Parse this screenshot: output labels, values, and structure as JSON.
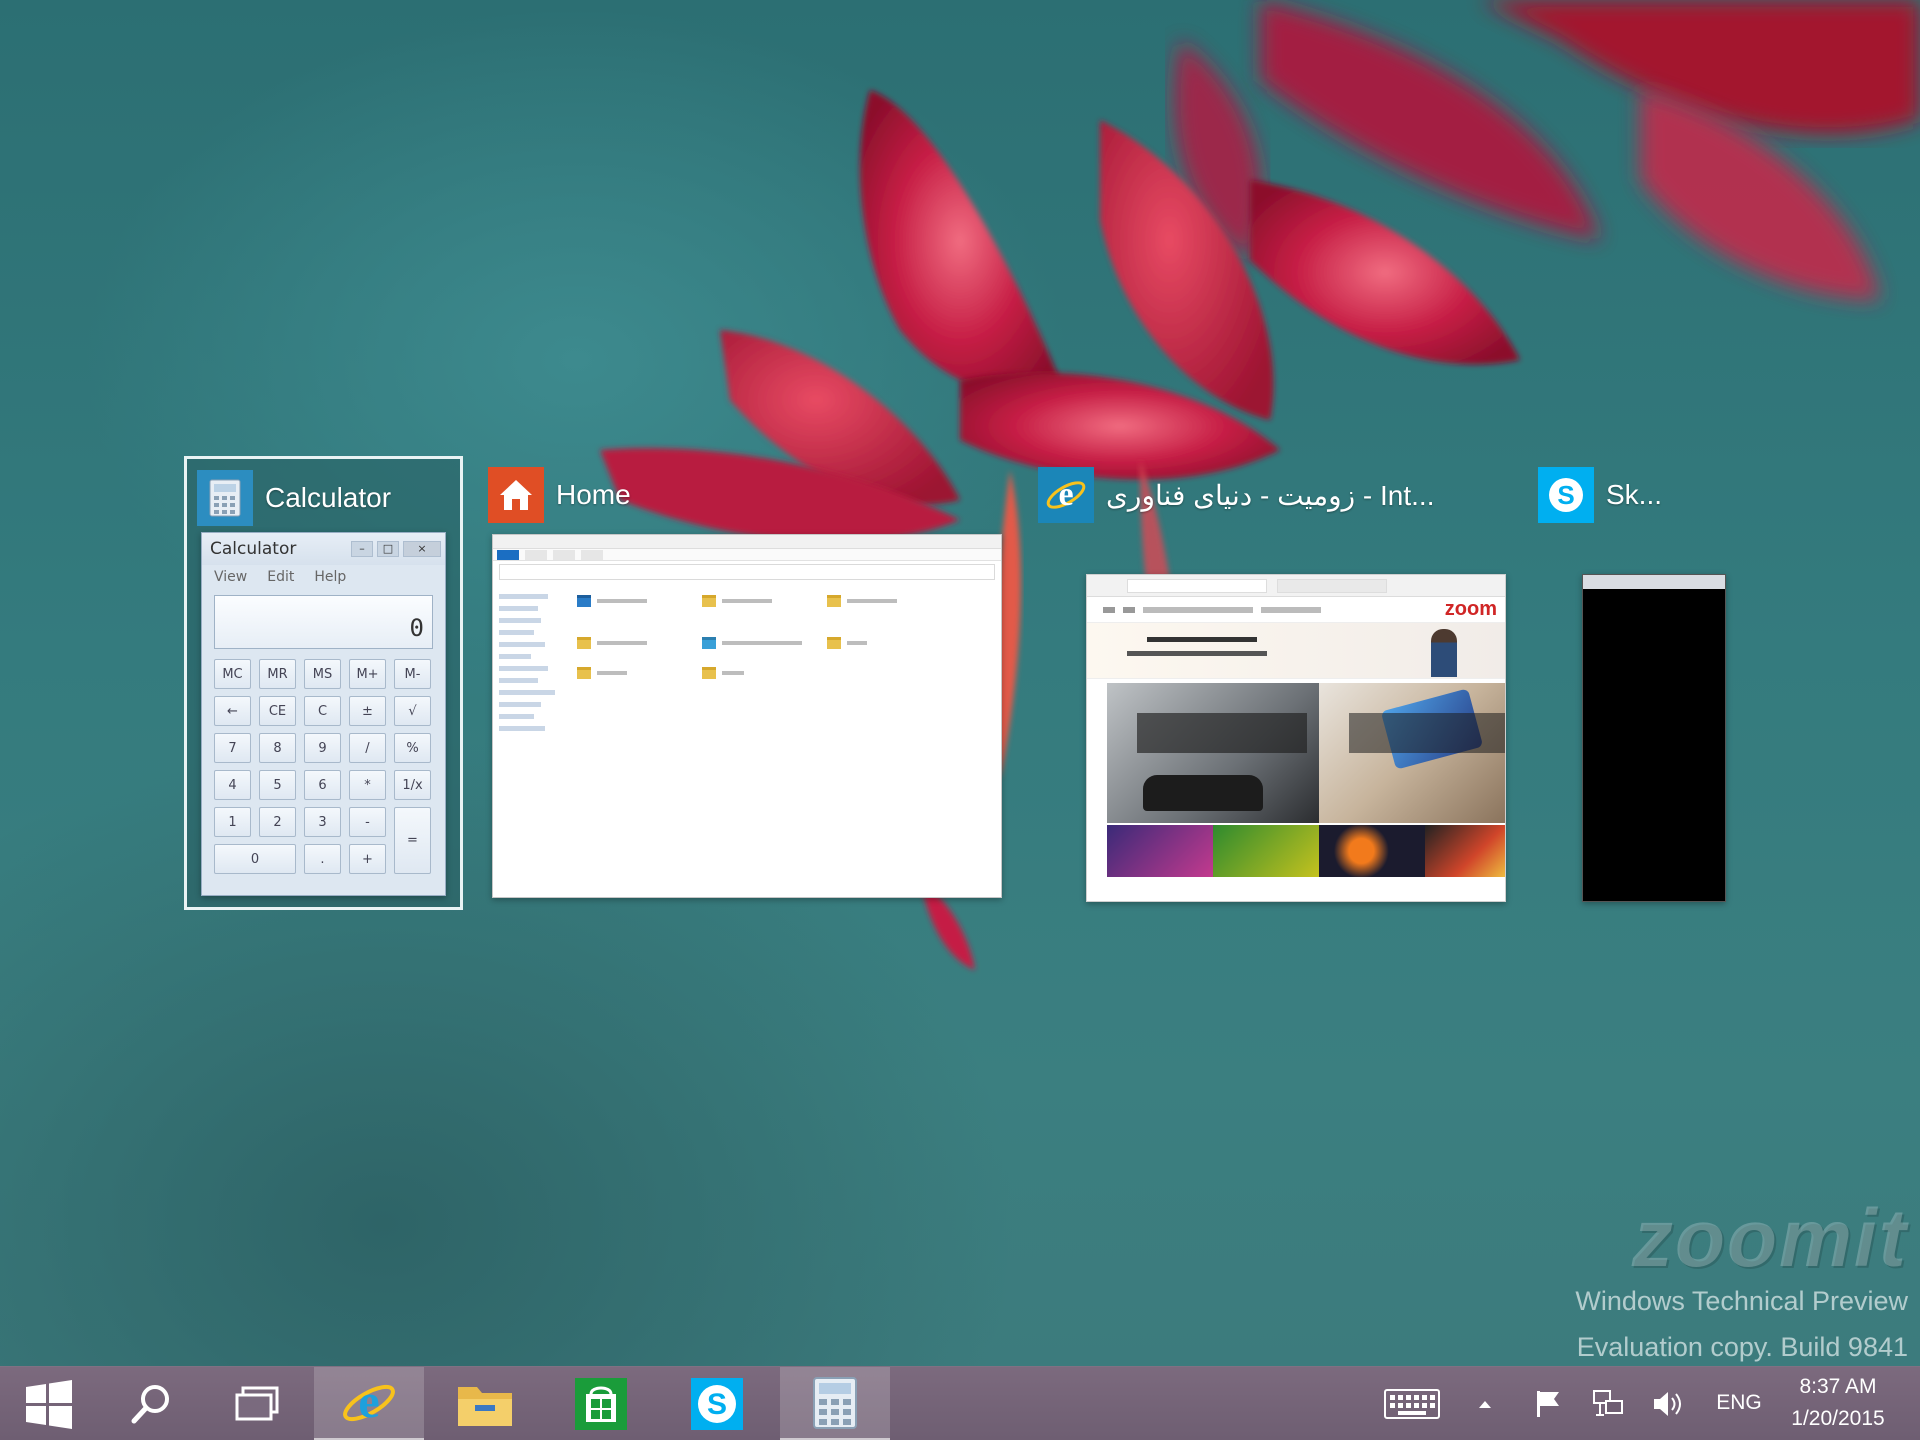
{
  "switcher": {
    "windows": [
      {
        "title": "Calculator",
        "selected": true
      },
      {
        "title": "Home",
        "selected": false
      },
      {
        "title": "زومیت - دنیای فناوری - Int...",
        "selected": false
      },
      {
        "title": "Sk...",
        "selected": false
      }
    ],
    "calculator": {
      "title": "Calculator",
      "menu": [
        "View",
        "Edit",
        "Help"
      ],
      "display": "0",
      "keys": [
        "MC",
        "MR",
        "MS",
        "M+",
        "M-",
        "←",
        "CE",
        "C",
        "±",
        "√",
        "7",
        "8",
        "9",
        "/",
        "%",
        "4",
        "5",
        "6",
        "*",
        "1/x",
        "1",
        "2",
        "3",
        "-",
        "=",
        "0",
        ".",
        "+"
      ]
    },
    "browser": {
      "brand": "zoom"
    }
  },
  "watermark": {
    "logo": "zoomit",
    "line1": "Windows Technical Preview",
    "line2": "Evaluation copy. Build 9841"
  },
  "taskbar": {
    "buttons": [
      {
        "name": "start",
        "icon": "windows-logo-icon"
      },
      {
        "name": "search",
        "icon": "search-icon"
      },
      {
        "name": "task-view",
        "icon": "task-view-icon"
      },
      {
        "name": "internet-explorer",
        "icon": "ie-icon",
        "active": true
      },
      {
        "name": "file-explorer",
        "icon": "folder-icon"
      },
      {
        "name": "store",
        "icon": "store-icon"
      },
      {
        "name": "skype",
        "icon": "skype-icon"
      },
      {
        "name": "calculator",
        "icon": "calculator-icon",
        "active": true
      }
    ],
    "tray": {
      "language": "ENG",
      "time": "8:37 AM",
      "date": "1/20/2015"
    }
  },
  "colors": {
    "taskbar": "#6e5e72",
    "selection_border": "#e9f3f4",
    "home_icon_bg": "#e04e25",
    "skype_blue": "#00aff0",
    "ie_blue": "#1ea0dc"
  }
}
